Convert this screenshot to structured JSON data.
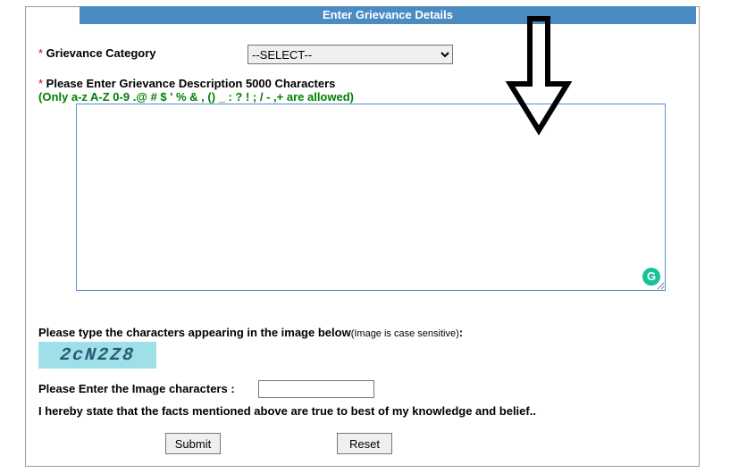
{
  "header": {
    "title": "Enter Grievance Details"
  },
  "category": {
    "label": "Grievance Category",
    "placeholder": "--SELECT--"
  },
  "description": {
    "label": "Please Enter Grievance Description 5000 Characters",
    "hint": "(Only a-z A-Z 0-9 .@ # $ ' % & , () _ : ? ! ; / - ,+ are allowed)"
  },
  "captcha": {
    "prompt_main": "Please type the characters appearing in the image below",
    "prompt_note": "(Image is case sensitive)",
    "colon": ":",
    "image_text": "2cN2Z8",
    "input_label": "Please Enter the Image characters :"
  },
  "declaration": "I hereby state that the facts mentioned above are true to best of my knowledge and belief..",
  "buttons": {
    "submit": "Submit",
    "reset": "Reset"
  },
  "grammarly_badge": "G"
}
